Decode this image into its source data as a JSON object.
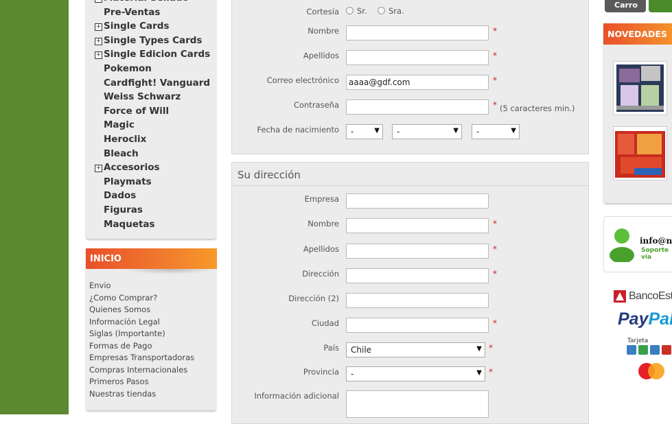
{
  "categories": [
    {
      "label": "Material Sellado",
      "expandable": true
    },
    {
      "label": "Pre-Ventas",
      "expandable": false
    },
    {
      "label": "Single Cards",
      "expandable": true
    },
    {
      "label": "Single Types Cards",
      "expandable": true
    },
    {
      "label": "Single Edicion Cards",
      "expandable": true
    },
    {
      "label": "Pokemon",
      "expandable": false
    },
    {
      "label": "Cardfight! Vanguard",
      "expandable": false
    },
    {
      "label": "Weiss Schwarz",
      "expandable": false
    },
    {
      "label": "Force of Will",
      "expandable": false
    },
    {
      "label": "Magic",
      "expandable": false
    },
    {
      "label": "Heroclix",
      "expandable": false
    },
    {
      "label": "Bleach",
      "expandable": false
    },
    {
      "label": "Accesorios",
      "expandable": true
    },
    {
      "label": "Playmats",
      "expandable": false
    },
    {
      "label": "Dados",
      "expandable": false
    },
    {
      "label": "Figuras",
      "expandable": false
    },
    {
      "label": "Maquetas",
      "expandable": false
    }
  ],
  "plus_sign": "+",
  "inicio": {
    "title": "INICIO",
    "links": [
      "Envio",
      "¿Como Comprar?",
      "Quienes Somos",
      "Información Legal",
      "Siglas (Importante)",
      "Formas de Pago",
      "Empresas Transportadoras",
      "Compras Internacionales",
      "Primeros Pasos",
      "Nuestras tiendas"
    ]
  },
  "personal": {
    "cortesia_label": "Cortesía",
    "cortesia_options": [
      "Sr.",
      "Sra."
    ],
    "nombre_label": "Nombre",
    "apellidos_label": "Apellidos",
    "email_label": "Correo electrónico",
    "email_value": "aaaa@gdf.com",
    "password_label": "Contraseña",
    "password_hint": "(5 caracteres min.)",
    "birthdate_label": "Fecha de nacimiento",
    "birth_day": "-",
    "birth_month": "-",
    "birth_year": "-"
  },
  "required_mark": "*",
  "dropdown_arrow": "▼",
  "address": {
    "title": "Su dirección",
    "empresa_label": "Empresa",
    "nombre_label": "Nombre",
    "apellidos_label": "Apellidos",
    "direccion_label": "Dirección",
    "direccion2_label": "Dirección (2)",
    "ciudad_label": "Ciudad",
    "pais_label": "País",
    "pais_value": "Chile",
    "provincia_label": "Provincia",
    "provincia_value": "-",
    "info_label": "Información adicional"
  },
  "right": {
    "cart_label": "Carro",
    "novedades_title": "NOVEDADES",
    "support_email": "info@nc",
    "support_text": "Soporte vía",
    "bank_name": "BancoEsta",
    "paypal": "PayPal",
    "tarjeta": "Tarjeta"
  },
  "colors": {
    "sidebar_green": "#5b8a33",
    "orange_header": "#f07b2e",
    "required": "#cc2222",
    "paypal_dark": "#253b80",
    "paypal_light": "#179bd7"
  }
}
